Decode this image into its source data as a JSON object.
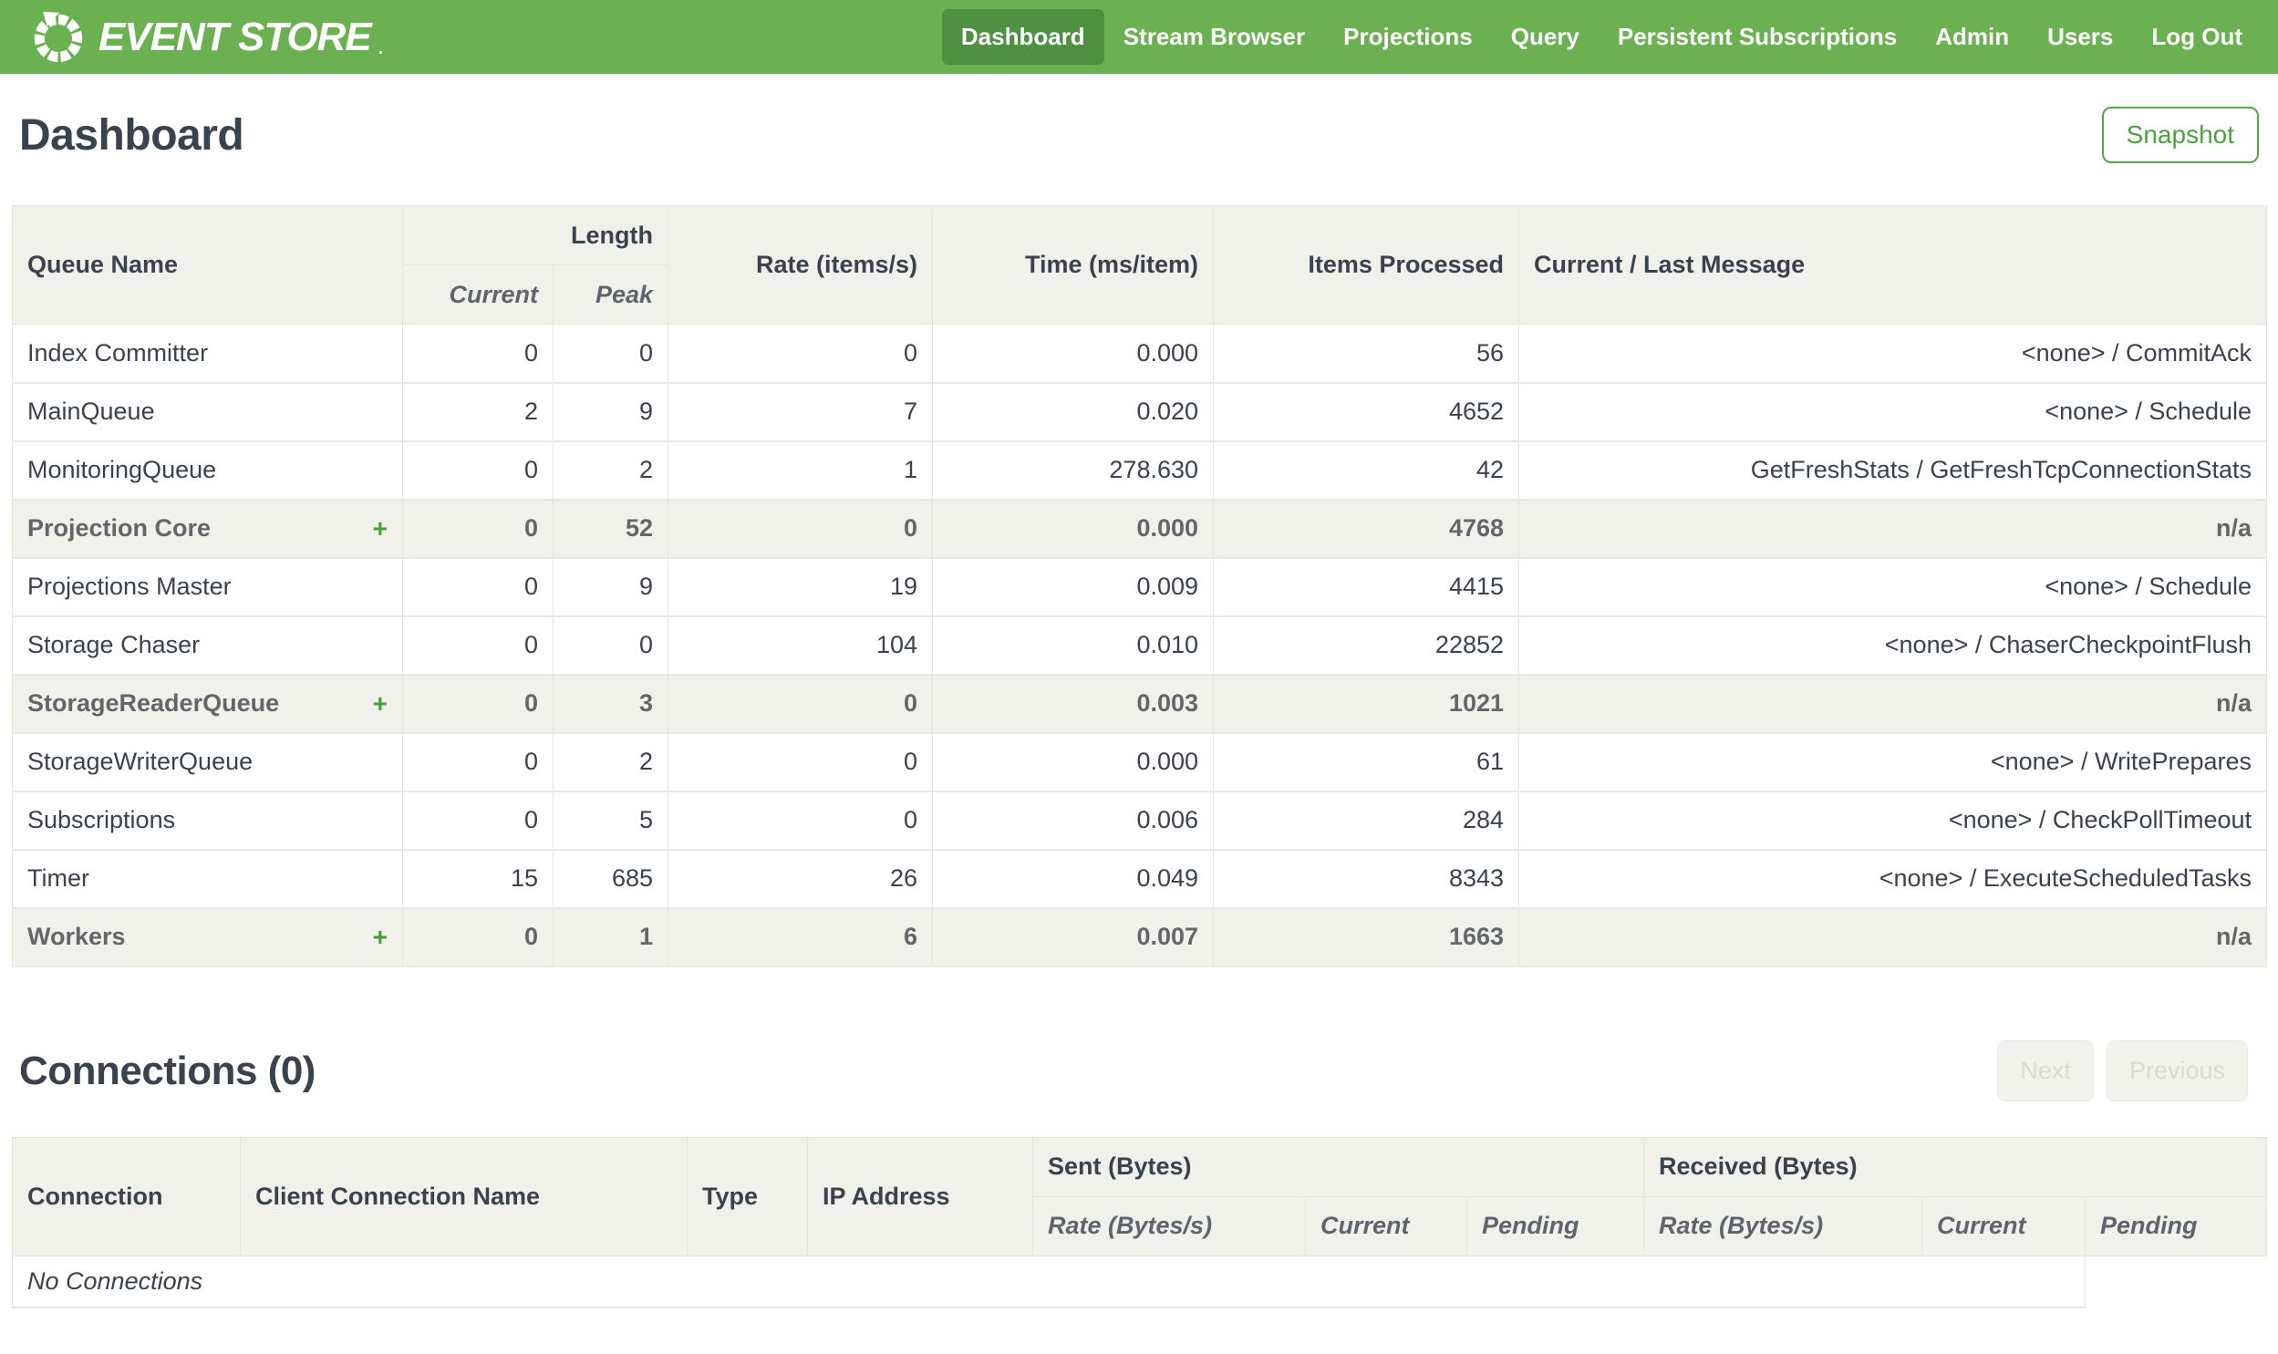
{
  "colors": {
    "navbar_bg": "#6CB151",
    "navbar_active_bg": "#4E9241",
    "accent_green": "#43A135",
    "header_bg": "#F0F1EB",
    "text_dark": "#39434E",
    "text_gray": "#63676A",
    "border_light": "#E3E5DC",
    "disabled_text": "#D9DCD2",
    "disabled_bg": "#F1F2EC",
    "snapshot_border": "#55A748",
    "snapshot_text": "#4CA23F"
  },
  "navbar": {
    "brand": "EVENT STORE",
    "brand_mark": ".",
    "items": [
      {
        "label": "Dashboard",
        "active": true
      },
      {
        "label": "Stream Browser",
        "active": false
      },
      {
        "label": "Projections",
        "active": false
      },
      {
        "label": "Query",
        "active": false
      },
      {
        "label": "Persistent Subscriptions",
        "active": false
      },
      {
        "label": "Admin",
        "active": false
      },
      {
        "label": "Users",
        "active": false
      },
      {
        "label": "Log Out",
        "active": false
      }
    ]
  },
  "page": {
    "title": "Dashboard",
    "snapshot_label": "Snapshot"
  },
  "queues_table": {
    "expand_symbol": "+",
    "headers": {
      "queue_name": "Queue Name",
      "length": "Length",
      "current": "Current",
      "peak": "Peak",
      "rate": "Rate (items/s)",
      "time": "Time (ms/item)",
      "items_processed": "Items Processed",
      "message": "Current / Last Message"
    },
    "rows": [
      {
        "name": "Index Committer",
        "group": false,
        "current": "0",
        "peak": "0",
        "rate": "0",
        "time": "0.000",
        "items": "56",
        "message": "<none> / CommitAck"
      },
      {
        "name": "MainQueue",
        "group": false,
        "current": "2",
        "peak": "9",
        "rate": "7",
        "time": "0.020",
        "items": "4652",
        "message": "<none> / Schedule"
      },
      {
        "name": "MonitoringQueue",
        "group": false,
        "current": "0",
        "peak": "2",
        "rate": "1",
        "time": "278.630",
        "items": "42",
        "message": "GetFreshStats / GetFreshTcpConnectionStats"
      },
      {
        "name": "Projection Core",
        "group": true,
        "current": "0",
        "peak": "52",
        "rate": "0",
        "time": "0.000",
        "items": "4768",
        "message": "n/a"
      },
      {
        "name": "Projections Master",
        "group": false,
        "current": "0",
        "peak": "9",
        "rate": "19",
        "time": "0.009",
        "items": "4415",
        "message": "<none> / Schedule"
      },
      {
        "name": "Storage Chaser",
        "group": false,
        "current": "0",
        "peak": "0",
        "rate": "104",
        "time": "0.010",
        "items": "22852",
        "message": "<none> / ChaserCheckpointFlush"
      },
      {
        "name": "StorageReaderQueue",
        "group": true,
        "current": "0",
        "peak": "3",
        "rate": "0",
        "time": "0.003",
        "items": "1021",
        "message": "n/a"
      },
      {
        "name": "StorageWriterQueue",
        "group": false,
        "current": "0",
        "peak": "2",
        "rate": "0",
        "time": "0.000",
        "items": "61",
        "message": "<none> / WritePrepares"
      },
      {
        "name": "Subscriptions",
        "group": false,
        "current": "0",
        "peak": "5",
        "rate": "0",
        "time": "0.006",
        "items": "284",
        "message": "<none> / CheckPollTimeout"
      },
      {
        "name": "Timer",
        "group": false,
        "current": "15",
        "peak": "685",
        "rate": "26",
        "time": "0.049",
        "items": "8343",
        "message": "<none> / ExecuteScheduledTasks"
      },
      {
        "name": "Workers",
        "group": true,
        "current": "0",
        "peak": "1",
        "rate": "6",
        "time": "0.007",
        "items": "1663",
        "message": "n/a"
      }
    ]
  },
  "connections": {
    "title": "Connections (0)",
    "next_label": "Next",
    "prev_label": "Previous"
  },
  "connections_table": {
    "headers": {
      "connection": "Connection",
      "client_connection_name": "Client Connection Name",
      "type": "Type",
      "ip_address": "IP Address",
      "sent": "Sent (Bytes)",
      "received": "Received (Bytes)",
      "rate": "Rate (Bytes/s)",
      "current": "Current",
      "pending": "Pending"
    },
    "empty_message": "No Connections"
  }
}
